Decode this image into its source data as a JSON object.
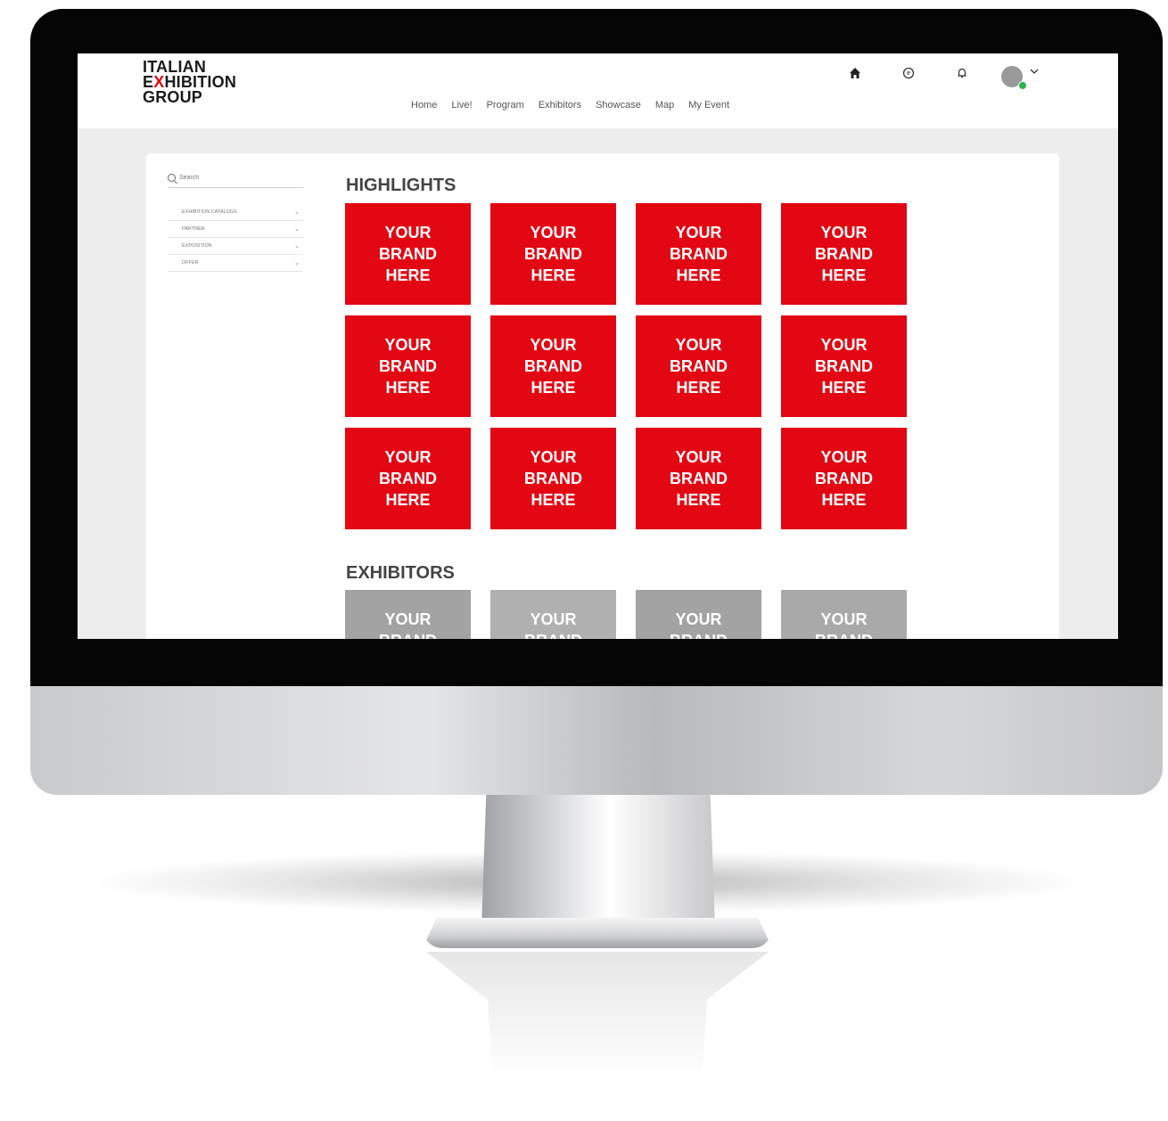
{
  "site": {
    "logo_lines": [
      "ITALIAN",
      "HIBITION",
      "GROUP"
    ],
    "logo_x": "X",
    "logo_e": "E"
  },
  "nav": {
    "items": [
      "Home",
      "Live!",
      "Program",
      "Exhibitors",
      "Showcase",
      "Map",
      "My Event"
    ]
  },
  "top_icons": [
    "home-icon",
    "chat-icon",
    "bell-icon",
    "avatar"
  ],
  "sidebar": {
    "search_placeholder": "Search",
    "filters": [
      "EXHIBITION CATALOGS",
      "PARTNER",
      "EXPOSITION",
      "OFFER"
    ]
  },
  "highlights": {
    "title": "HIGHLIGHTS",
    "tile_text": "YOUR\nBRAND\nHERE",
    "tile_color": "#e30613",
    "count": 12
  },
  "exhibitors": {
    "title": "EXHIBITORS",
    "tile_text": "YOUR\nBRAND\nHERE",
    "tile_colors": [
      "#a3a3a3",
      "#b0b0b0",
      "#a3a3a3",
      "#a9a9a9"
    ]
  },
  "colors": {
    "accent": "#e30613",
    "status_online": "#2db34a"
  }
}
